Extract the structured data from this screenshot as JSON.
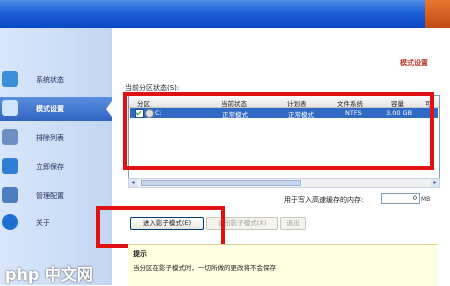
{
  "nav": {
    "items": [
      {
        "label": "系统状态",
        "icon": "monitor-icon",
        "color": "#3a8fd8"
      },
      {
        "label": "模式设置",
        "icon": "settings-icon",
        "color": "#5ab0f0"
      },
      {
        "label": "排除列表",
        "icon": "list-icon",
        "color": "#6d8fc4"
      },
      {
        "label": "立即保存",
        "icon": "save-icon",
        "color": "#2f7fd6"
      },
      {
        "label": "管理配置",
        "icon": "config-icon",
        "color": "#4b7fc0"
      },
      {
        "label": "关于",
        "icon": "info-icon",
        "color": "#1f6fd0"
      }
    ],
    "active_index": 1
  },
  "header": {
    "title": "模式设置"
  },
  "partition": {
    "section_label": "当前分区状态(S):",
    "columns": [
      "分区",
      "当前状态",
      "计划表",
      "文件系统",
      "容量",
      "可"
    ],
    "rows": [
      {
        "checked": true,
        "name": "C:",
        "status": "正常模式",
        "plan": "正常模式",
        "fs": "NTFS",
        "size": "3.00 GB"
      }
    ]
  },
  "cache": {
    "label": "用于写入高速缓存的内存:",
    "value": "0",
    "unit": "MB"
  },
  "buttons": {
    "enter": "进入影子模式(E)",
    "exit": "退出影子模式(X)",
    "other": "退出"
  },
  "tip": {
    "title": "提示",
    "text": "当分区在影子模式时，一切所做的更改将不会保存"
  },
  "watermark": "php 中文网",
  "colors": {
    "accent": "#316ac5",
    "highlight": "#e01111"
  }
}
